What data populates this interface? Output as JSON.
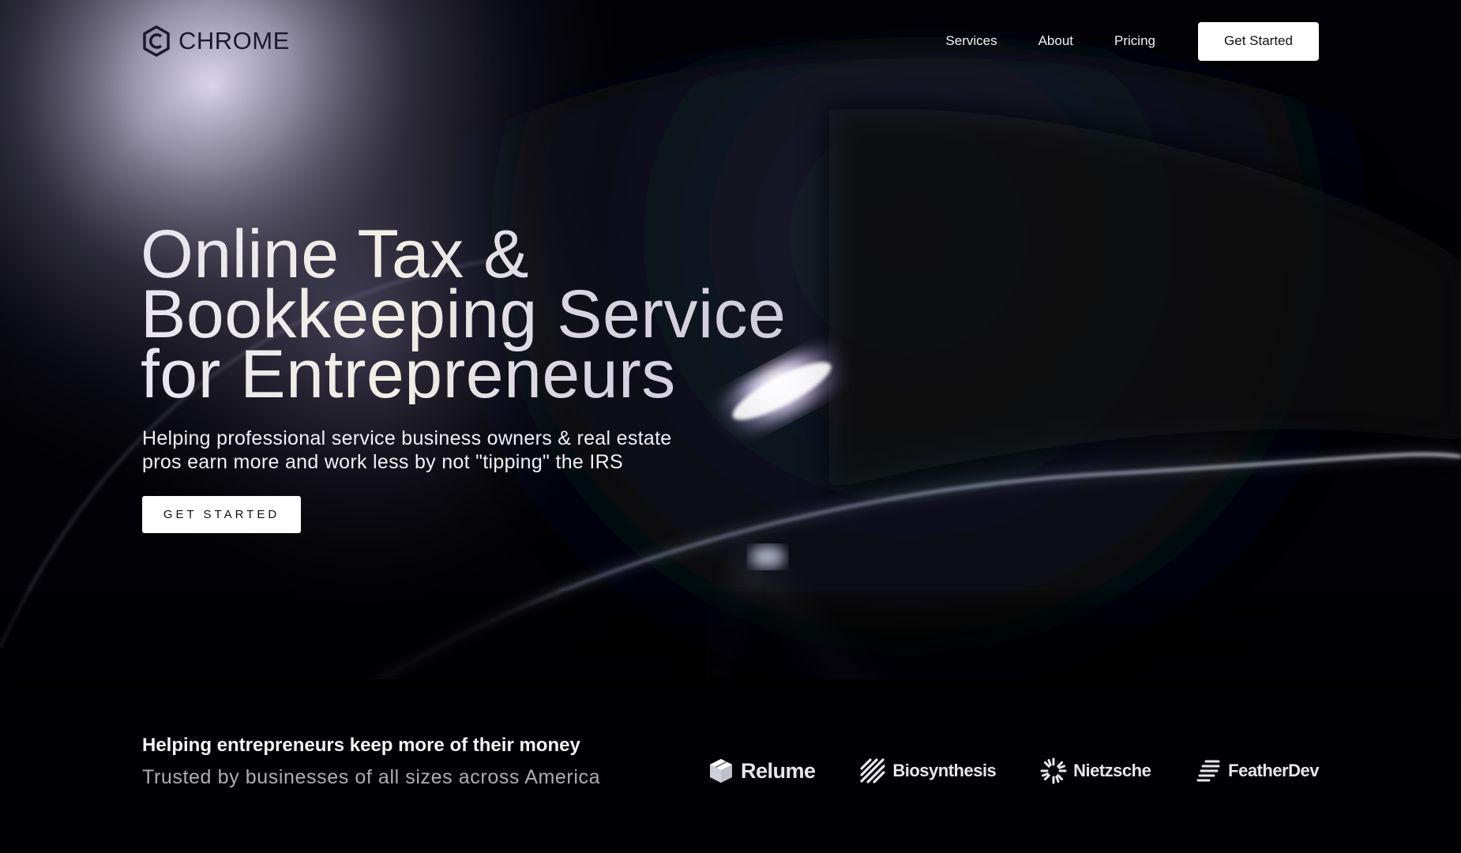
{
  "header": {
    "logo_text": "CHROME",
    "logo_icon": "hexagon-c-icon",
    "nav": [
      "Services",
      "About",
      "Pricing"
    ],
    "cta_label": "Get Started"
  },
  "hero": {
    "title_lines": [
      "Online Tax &",
      "Bookkeeping Service",
      "for Entrepreneurs"
    ],
    "subtitle_lines": [
      "Helping professional service business owners & real estate",
      "pros earn more and work less by not \"tipping\" the IRS"
    ],
    "cta_label": "GET STARTED"
  },
  "trust": {
    "heading": "Helping entrepreneurs keep more of their money",
    "subheading": "Trusted by businesses of all sizes across America",
    "logos": [
      {
        "name": "Relume",
        "icon": "cube-icon"
      },
      {
        "name": "Biosynthesis",
        "icon": "diagonal-stripes-icon"
      },
      {
        "name": "Nietzsche",
        "icon": "sunburst-icon"
      },
      {
        "name": "FeatherDev",
        "icon": "feather-lines-icon"
      }
    ]
  },
  "colors": {
    "background": "#020206",
    "accent_glow": "#d9d3f0",
    "text_primary": "#f2f2f6",
    "text_muted": "#aeadb6",
    "button_bg": "#ffffff"
  }
}
